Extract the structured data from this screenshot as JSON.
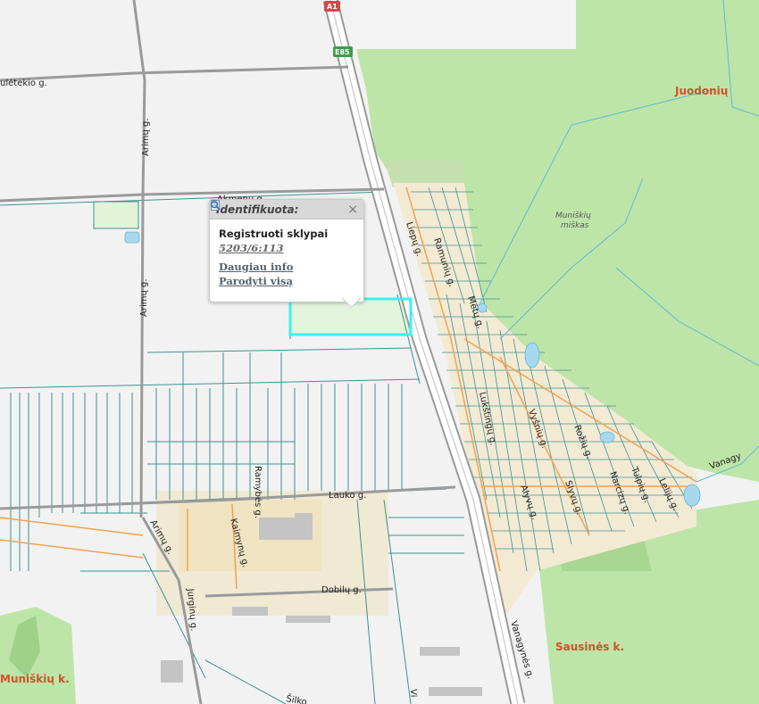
{
  "map": {
    "streets": {
      "uletekio": "ulėtekio g.",
      "arimu_top": "Arimų g.",
      "arimu_mid": "Arimų g.",
      "arimu_bottom": "Arimų g.",
      "akmenu": "Akmenų g.",
      "liepu": "Liepų g.",
      "ramunu": "Ramunių g.",
      "metu": "Mėtų g.",
      "lukstingu": "Lukštingų g.",
      "vysniu": "Vyšnių g.",
      "rozu": "Rožių g.",
      "slyvu": "Slyvų g.",
      "alyvu": "Alyvų g.",
      "nareizu": "Narcizų g.",
      "tulpiu": "Tulpių g.",
      "lelijos": "Lelijų g.",
      "lauko": "Lauko g.",
      "ramybes": "Ramybės g.",
      "kaimyn": "Kaimynų g.",
      "jurginu": "Jurginų g.",
      "dobilu": "Dobilų g.",
      "vanagynes": "Vanagynės g.",
      "vanagy_right": "Vanagy",
      "silko": "Šilko",
      "vi": "Vi"
    },
    "places": {
      "juodoniu": "Juodonių",
      "sausines": "Sausinės k.",
      "muniskiu": "Muniškių k."
    },
    "forest_label": [
      "Muniškių",
      "miškas"
    ],
    "road_shields": {
      "a1": "A1",
      "e85": "E85"
    },
    "colors": {
      "forest": "#bde5a8",
      "background": "#f2f2f2",
      "parcel_line": "#3e9393",
      "road_orange": "#f3a250",
      "selected": "#3ff0f0",
      "place_label": "#d2502a"
    }
  },
  "popup": {
    "title": "Identifikuota:",
    "close": "×",
    "layer": "Registruoti sklypai",
    "parcel_id": "5203/6:113",
    "more_info": "Daugiau info",
    "show_all": "Parodyti visą",
    "more_info_icon": "document-icon",
    "show_all_icon": "magnifier-icon"
  }
}
